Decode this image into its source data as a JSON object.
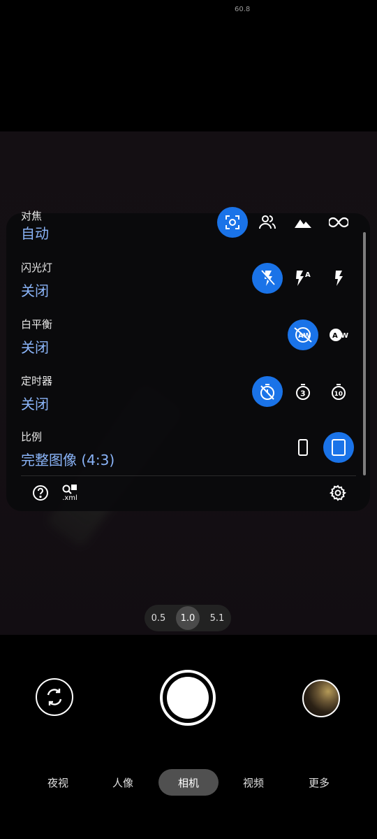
{
  "status": {
    "fps": "60.8"
  },
  "settings": {
    "rows": [
      {
        "title": "对焦",
        "value": "自动",
        "options": [
          "auto-focus-icon",
          "portrait-focus-icon",
          "landscape-icon",
          "infinity-icon"
        ],
        "selected": 0
      },
      {
        "title": "闪光灯",
        "value": "关闭",
        "options": [
          "flash-off-icon",
          "flash-auto-icon",
          "flash-on-icon"
        ],
        "selected": 0
      },
      {
        "title": "白平衡",
        "value": "关闭",
        "options": [
          "awb-off-icon",
          "awb-icon"
        ],
        "selected": 0
      },
      {
        "title": "定时器",
        "value": "关闭",
        "options": [
          "timer-off-icon",
          "timer-3-icon",
          "timer-10-icon"
        ],
        "selected": 0
      },
      {
        "title": "比例",
        "value": "完整图像 (4:3)",
        "options": [
          "ratio-tall-icon",
          "ratio-43-icon"
        ],
        "selected": 1
      }
    ],
    "tools": {
      "help_icon": "help-icon",
      "xml_label": ".xml",
      "settings_icon": "gear-icon"
    }
  },
  "zoom": {
    "levels": [
      "0.5",
      "1.0",
      "5.1"
    ],
    "selected": 1
  },
  "controls": {
    "flip": "camera-switch-icon",
    "shutter": "shutter-button",
    "gallery": "gallery-thumbnail"
  },
  "modes": {
    "items": [
      "夜视",
      "人像",
      "相机",
      "视频",
      "更多"
    ],
    "selected": 2
  },
  "colors": {
    "accent": "#1a73e8",
    "value_text": "#8ab4f8",
    "panel_bg": "#0a0a0c"
  }
}
